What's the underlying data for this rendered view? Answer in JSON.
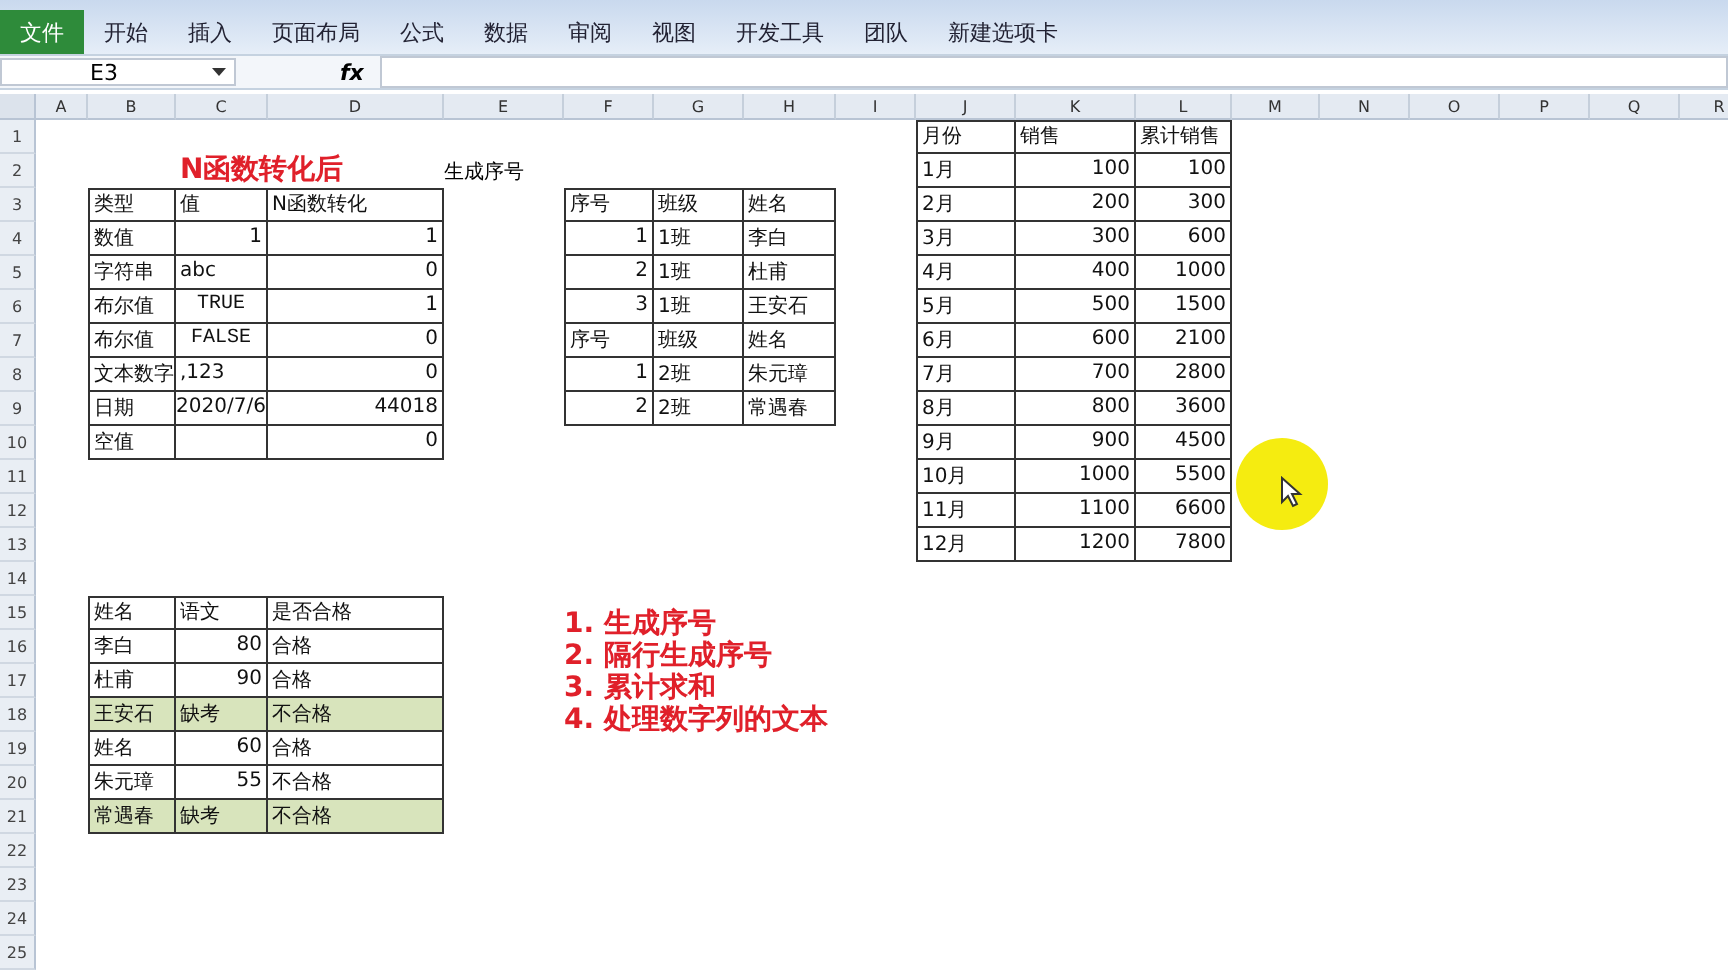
{
  "ribbon": {
    "file_tab": "文件",
    "tabs": [
      "开始",
      "插入",
      "页面布局",
      "公式",
      "数据",
      "审阅",
      "视图",
      "开发工具",
      "团队",
      "新建选项卡"
    ]
  },
  "formula_bar": {
    "name_box": "E3",
    "fx": "fx"
  },
  "sheet": {
    "columns": [
      "A",
      "B",
      "C",
      "D",
      "E",
      "F",
      "G",
      "H",
      "I",
      "J",
      "K",
      "L",
      "M",
      "N",
      "O",
      "P",
      "Q",
      "R"
    ],
    "rows": [
      "1",
      "2",
      "3",
      "4",
      "5",
      "6",
      "7",
      "8",
      "9",
      "10",
      "11",
      "12",
      "13",
      "14",
      "15",
      "16",
      "17",
      "18",
      "19",
      "20",
      "21",
      "22",
      "23",
      "24",
      "25"
    ],
    "labels": [
      {
        "text": "N函数转化后",
        "kind": "heading"
      },
      {
        "text": "生成序号",
        "kind": "plain"
      }
    ],
    "tables": [
      {
        "rows": [
          {
            "highlighted": false,
            "cells": [
              "类型",
              "值",
              "N函数转化"
            ]
          },
          {
            "highlighted": false,
            "cells": [
              "数值",
              {
                "text": "1",
                "kind": "number"
              },
              {
                "text": "1",
                "kind": "number"
              }
            ]
          },
          {
            "highlighted": false,
            "cells": [
              "字符串",
              "abc",
              {
                "text": "0",
                "kind": "number"
              }
            ]
          },
          {
            "highlighted": false,
            "cells": [
              "布尔值",
              {
                "text": "TRUE",
                "kind": "boolean"
              },
              {
                "text": "1",
                "kind": "number"
              }
            ]
          },
          {
            "highlighted": false,
            "cells": [
              "布尔值",
              {
                "text": "FALSE",
                "kind": "boolean"
              },
              {
                "text": "0",
                "kind": "number"
              }
            ]
          },
          {
            "highlighted": false,
            "cells": [
              "文本数字",
              ",123",
              {
                "text": "0",
                "kind": "number"
              }
            ]
          },
          {
            "highlighted": false,
            "cells": [
              "日期",
              {
                "text": "2020/7/6",
                "kind": "date"
              },
              {
                "text": "44018",
                "kind": "number"
              }
            ]
          },
          {
            "highlighted": false,
            "cells": [
              "空值",
              "",
              {
                "text": "0",
                "kind": "number"
              }
            ]
          }
        ]
      },
      {
        "rows": [
          {
            "highlighted": false,
            "cells": [
              "序号",
              "班级",
              "姓名"
            ]
          },
          {
            "highlighted": false,
            "cells": [
              {
                "text": "1",
                "kind": "number"
              },
              "1班",
              "李白"
            ]
          },
          {
            "highlighted": false,
            "cells": [
              {
                "text": "2",
                "kind": "number"
              },
              "1班",
              "杜甫"
            ]
          },
          {
            "highlighted": false,
            "cells": [
              {
                "text": "3",
                "kind": "number"
              },
              "1班",
              "王安石"
            ]
          },
          {
            "highlighted": false,
            "cells": [
              "序号",
              "班级",
              "姓名"
            ]
          },
          {
            "highlighted": false,
            "cells": [
              {
                "text": "1",
                "kind": "number"
              },
              "2班",
              "朱元璋"
            ]
          },
          {
            "highlighted": false,
            "cells": [
              {
                "text": "2",
                "kind": "number"
              },
              "2班",
              "常遇春"
            ]
          }
        ]
      },
      {
        "rows": [
          {
            "highlighted": false,
            "cells": [
              "月份",
              "销售",
              "累计销售"
            ]
          },
          {
            "highlighted": false,
            "cells": [
              "1月",
              {
                "text": "100",
                "kind": "number"
              },
              {
                "text": "100",
                "kind": "number"
              }
            ]
          },
          {
            "highlighted": false,
            "cells": [
              "2月",
              {
                "text": "200",
                "kind": "number"
              },
              {
                "text": "300",
                "kind": "number"
              }
            ]
          },
          {
            "highlighted": false,
            "cells": [
              "3月",
              {
                "text": "300",
                "kind": "number"
              },
              {
                "text": "600",
                "kind": "number"
              }
            ]
          },
          {
            "highlighted": false,
            "cells": [
              "4月",
              {
                "text": "400",
                "kind": "number"
              },
              {
                "text": "1000",
                "kind": "number"
              }
            ]
          },
          {
            "highlighted": false,
            "cells": [
              "5月",
              {
                "text": "500",
                "kind": "number"
              },
              {
                "text": "1500",
                "kind": "number"
              }
            ]
          },
          {
            "highlighted": false,
            "cells": [
              "6月",
              {
                "text": "600",
                "kind": "number"
              },
              {
                "text": "2100",
                "kind": "number"
              }
            ]
          },
          {
            "highlighted": false,
            "cells": [
              "7月",
              {
                "text": "700",
                "kind": "number"
              },
              {
                "text": "2800",
                "kind": "number"
              }
            ]
          },
          {
            "highlighted": false,
            "cells": [
              "8月",
              {
                "text": "800",
                "kind": "number"
              },
              {
                "text": "3600",
                "kind": "number"
              }
            ]
          },
          {
            "highlighted": false,
            "cells": [
              "9月",
              {
                "text": "900",
                "kind": "number"
              },
              {
                "text": "4500",
                "kind": "number"
              }
            ]
          },
          {
            "highlighted": false,
            "cells": [
              "10月",
              {
                "text": "1000",
                "kind": "number"
              },
              {
                "text": "5500",
                "kind": "number"
              }
            ]
          },
          {
            "highlighted": false,
            "cells": [
              "11月",
              {
                "text": "1100",
                "kind": "number"
              },
              {
                "text": "6600",
                "kind": "number"
              }
            ]
          },
          {
            "highlighted": false,
            "cells": [
              "12月",
              {
                "text": "1200",
                "kind": "number"
              },
              {
                "text": "7800",
                "kind": "number"
              }
            ]
          }
        ]
      },
      {
        "rows": [
          {
            "highlighted": false,
            "cells": [
              "姓名",
              "语文",
              "是否合格"
            ]
          },
          {
            "highlighted": false,
            "cells": [
              "李白",
              {
                "text": "80",
                "kind": "number"
              },
              "合格"
            ]
          },
          {
            "highlighted": false,
            "cells": [
              "杜甫",
              {
                "text": "90",
                "kind": "number"
              },
              "合格"
            ]
          },
          {
            "highlighted": true,
            "cells": [
              "王安石",
              "缺考",
              "不合格"
            ]
          },
          {
            "highlighted": false,
            "cells": [
              "姓名",
              {
                "text": "60",
                "kind": "number"
              },
              "合格"
            ]
          },
          {
            "highlighted": false,
            "cells": [
              "朱元璋",
              {
                "text": "55",
                "kind": "number"
              },
              "不合格"
            ]
          },
          {
            "highlighted": true,
            "cells": [
              "常遇春",
              "缺考",
              "不合格"
            ]
          }
        ]
      }
    ],
    "notes": {
      "items": [
        "1. 生成序号",
        "2. 隔行生成序号",
        "3. 累计求和",
        "4. 处理数字列的文本"
      ]
    }
  }
}
